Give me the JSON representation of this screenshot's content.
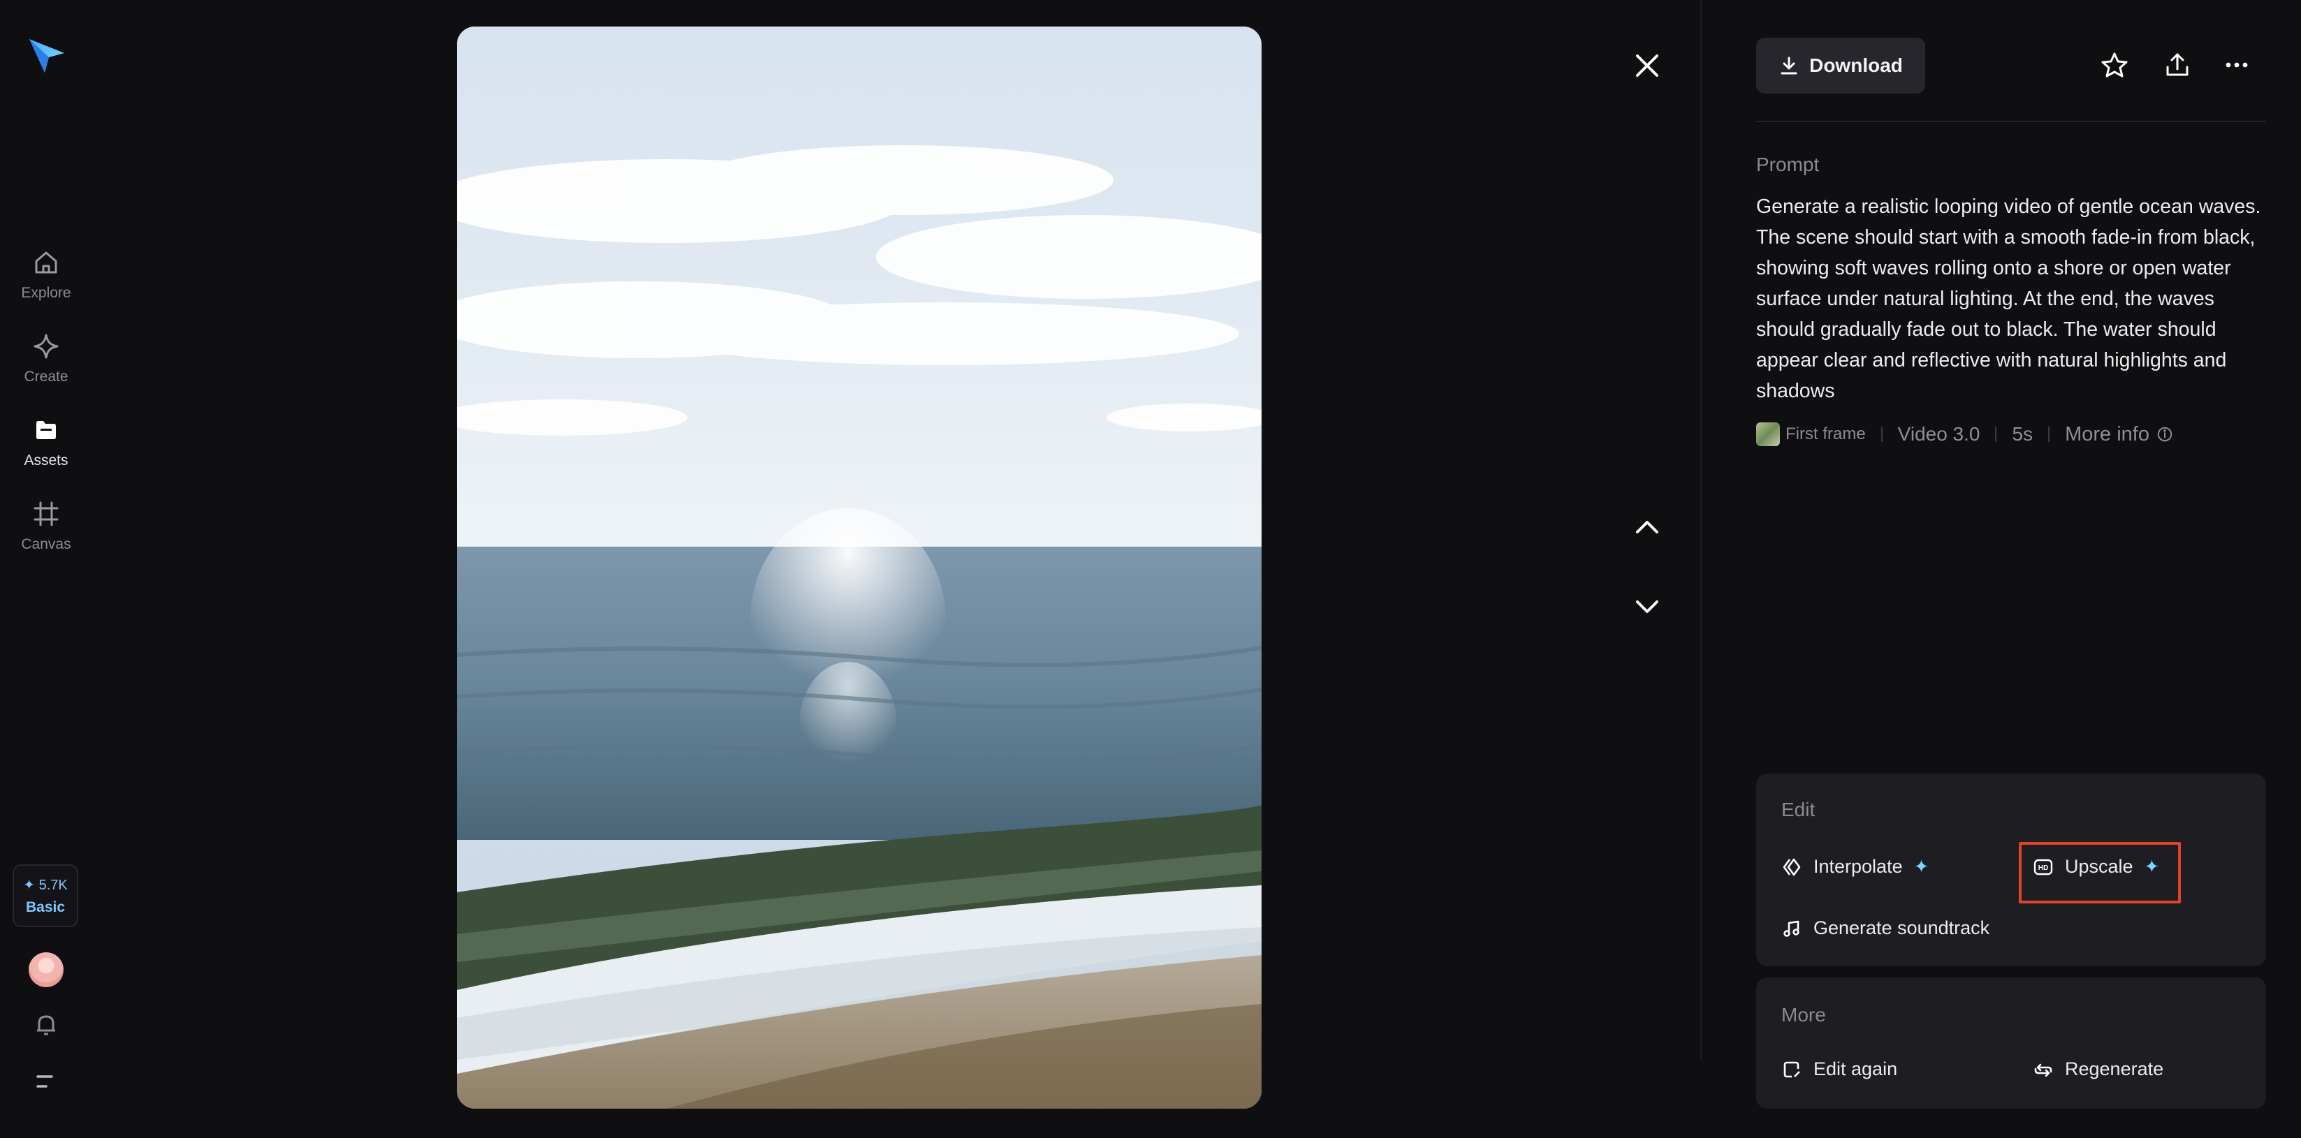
{
  "nav": {
    "items": [
      {
        "label": "Explore",
        "icon": "home-icon"
      },
      {
        "label": "Create",
        "icon": "sparkle-diamond-icon"
      },
      {
        "label": "Assets",
        "icon": "folder-icon",
        "active": true
      },
      {
        "label": "Canvas",
        "icon": "frame-grid-icon"
      }
    ],
    "credits": {
      "amount": "✦ 5.7K",
      "plan": "Basic"
    }
  },
  "toolbar": {
    "download_label": "Download"
  },
  "prompt": {
    "label": "Prompt",
    "text": "Generate a realistic looping video of gentle ocean waves. The scene should start with a smooth fade-in from black, showing soft waves rolling onto a shore or open water surface under natural lighting. At the end, the waves should gradually fade out to black. The water should appear clear and reflective with natural highlights and shadows"
  },
  "meta": {
    "first_frame": "First frame",
    "model": "Video 3.0",
    "duration": "5s",
    "more_info": "More info"
  },
  "edit": {
    "title": "Edit",
    "interpolate": "Interpolate",
    "upscale": "Upscale",
    "soundtrack": "Generate soundtrack"
  },
  "more": {
    "title": "More",
    "edit_again": "Edit again",
    "regenerate": "Regenerate"
  },
  "colors": {
    "background": "#0f0f12",
    "card": "#1d1d22",
    "accent": "#78d8ff",
    "highlight": "#e4412c"
  }
}
